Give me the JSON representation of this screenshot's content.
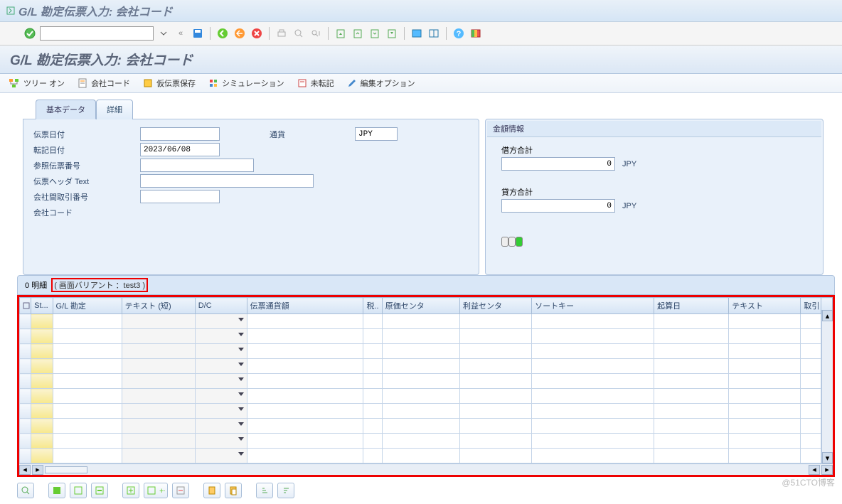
{
  "topbar": {
    "title": "G/L 勘定伝票入力: 会社コード"
  },
  "subheader": {
    "title": "G/L 勘定伝票入力: 会社コード"
  },
  "toolbar2": {
    "tree_on": "ツリー オン",
    "company_code": "会社コード",
    "park": "仮伝票保存",
    "simulate": "シミュレーション",
    "not_posted": "未転記",
    "edit_options": "編集オプション"
  },
  "tabs": {
    "basic": "基本データ",
    "detail": "詳細"
  },
  "form": {
    "doc_date_label": "伝票日付",
    "doc_date": "",
    "currency_label": "通貨",
    "currency": "JPY",
    "post_date_label": "転記日付",
    "post_date": "2023/06/08",
    "ref_no_label": "参照伝票番号",
    "ref_no": "",
    "header_text_label": "伝票ヘッダ Text",
    "header_text": "",
    "intco_label": "会社間取引番号",
    "intco": "",
    "cocode_label": "会社コード",
    "cocode": ""
  },
  "amount_panel": {
    "title": "金額情報",
    "debit_label": "借方合計",
    "debit": "0",
    "debit_curr": "JPY",
    "credit_label": "貸方合計",
    "credit": "0",
    "credit_curr": "JPY"
  },
  "table_header": {
    "count_label": "0 明細",
    "variant_prefix": "( 画面バリアント ：",
    "variant": "test3",
    "variant_suffix": " )"
  },
  "columns": {
    "st": "St...",
    "gl": "G/L 勘定",
    "text_short": "テキスト (短)",
    "dc": "D/C",
    "doc_curr_amt": "伝票通貨額",
    "tax": "税..",
    "cost_center": "原価センタ",
    "profit_center": "利益センタ",
    "sort_key": "ソートキー",
    "value_date": "起算日",
    "text": "テキスト",
    "tr": "取引"
  },
  "watermark": "@51CTO博客"
}
